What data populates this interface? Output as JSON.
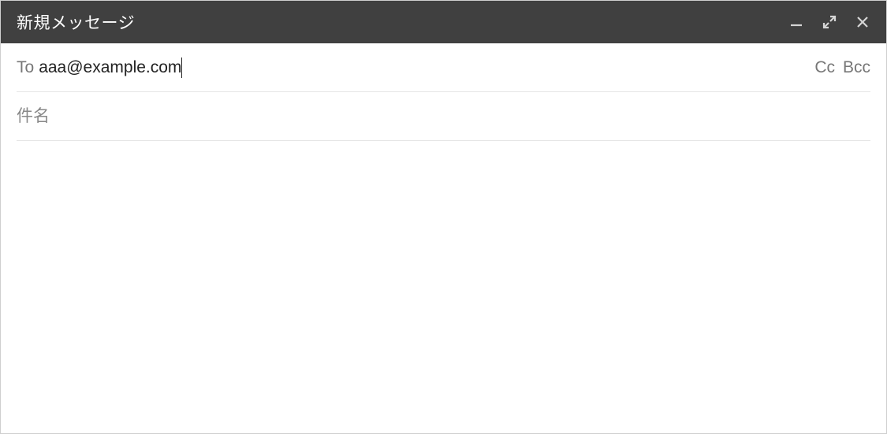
{
  "titlebar": {
    "title": "新規メッセージ"
  },
  "to": {
    "label": "To",
    "value": "aaa@example.com",
    "cc_label": "Cc",
    "bcc_label": "Bcc"
  },
  "subject": {
    "placeholder": "件名",
    "value": ""
  },
  "body": {
    "value": ""
  }
}
